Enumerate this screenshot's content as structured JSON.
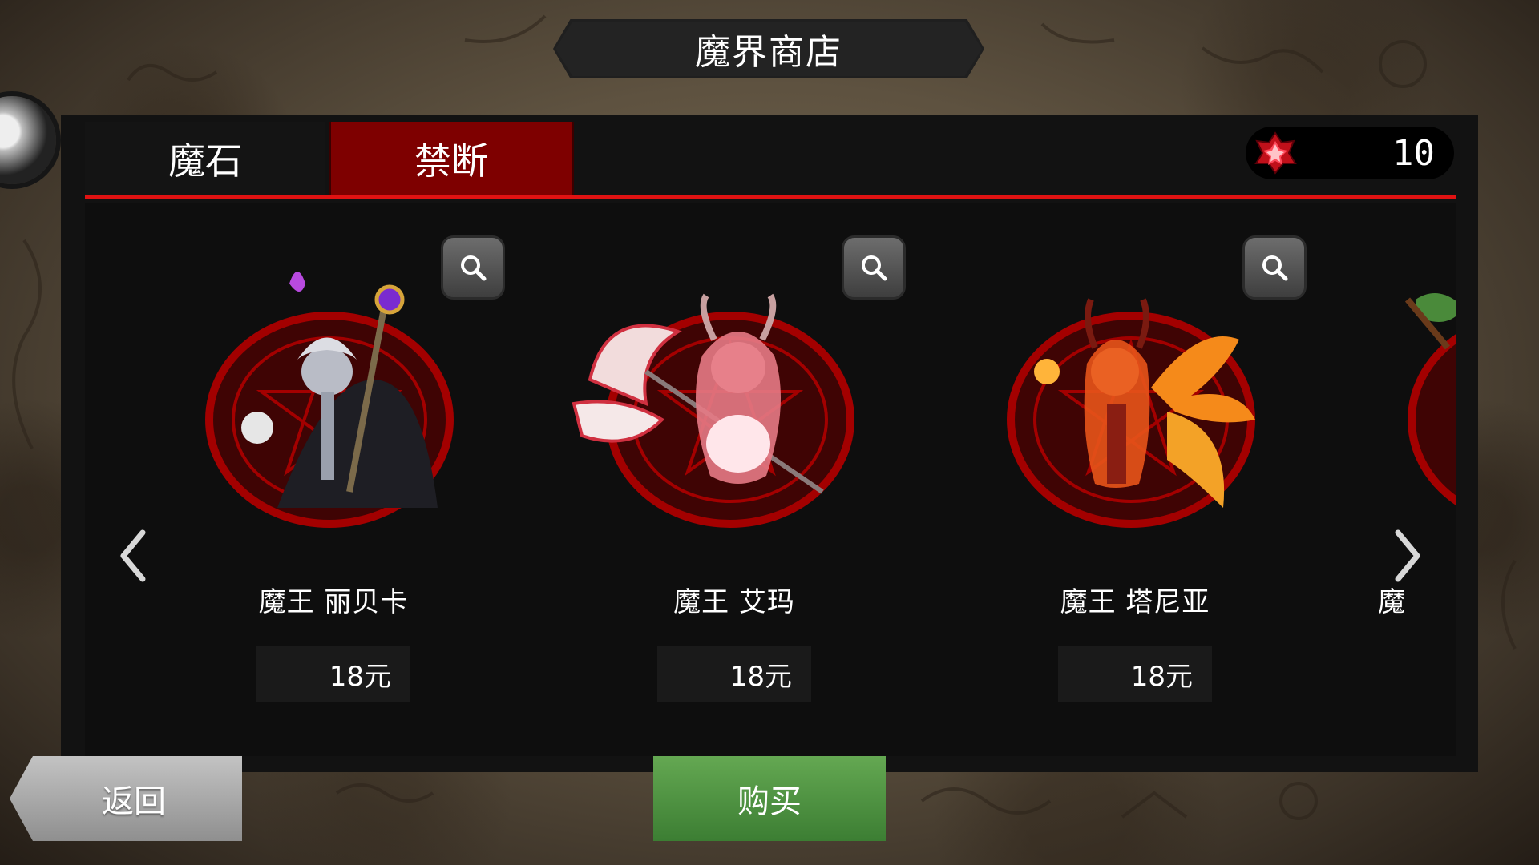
{
  "header": {
    "title": "魔界商店"
  },
  "tabs": [
    {
      "label": "魔石",
      "active": false
    },
    {
      "label": "禁断",
      "active": true
    }
  ],
  "currency": {
    "icon": "red-gem-icon",
    "value": "10"
  },
  "items": [
    {
      "name": "魔王  丽贝卡",
      "price": "18元",
      "theme_color": "#c8c8d0"
    },
    {
      "name": "魔王  艾玛",
      "price": "18元",
      "theme_color": "#e88a96"
    },
    {
      "name": "魔王  塔尼亚",
      "price": "18元",
      "theme_color": "#f59a1e"
    },
    {
      "name": "魔",
      "price": "",
      "theme_color": "#4a8a3a"
    }
  ],
  "nav": {
    "prev_icon": "chevron-left-icon",
    "next_icon": "chevron-right-icon"
  },
  "buttons": {
    "back_label": "返回",
    "buy_label": "购买"
  },
  "colors": {
    "accent_red": "#e01212",
    "active_tab": "#7e0000",
    "buy_green": "#4a8f3e",
    "back_gray": "#a8a8a8"
  }
}
